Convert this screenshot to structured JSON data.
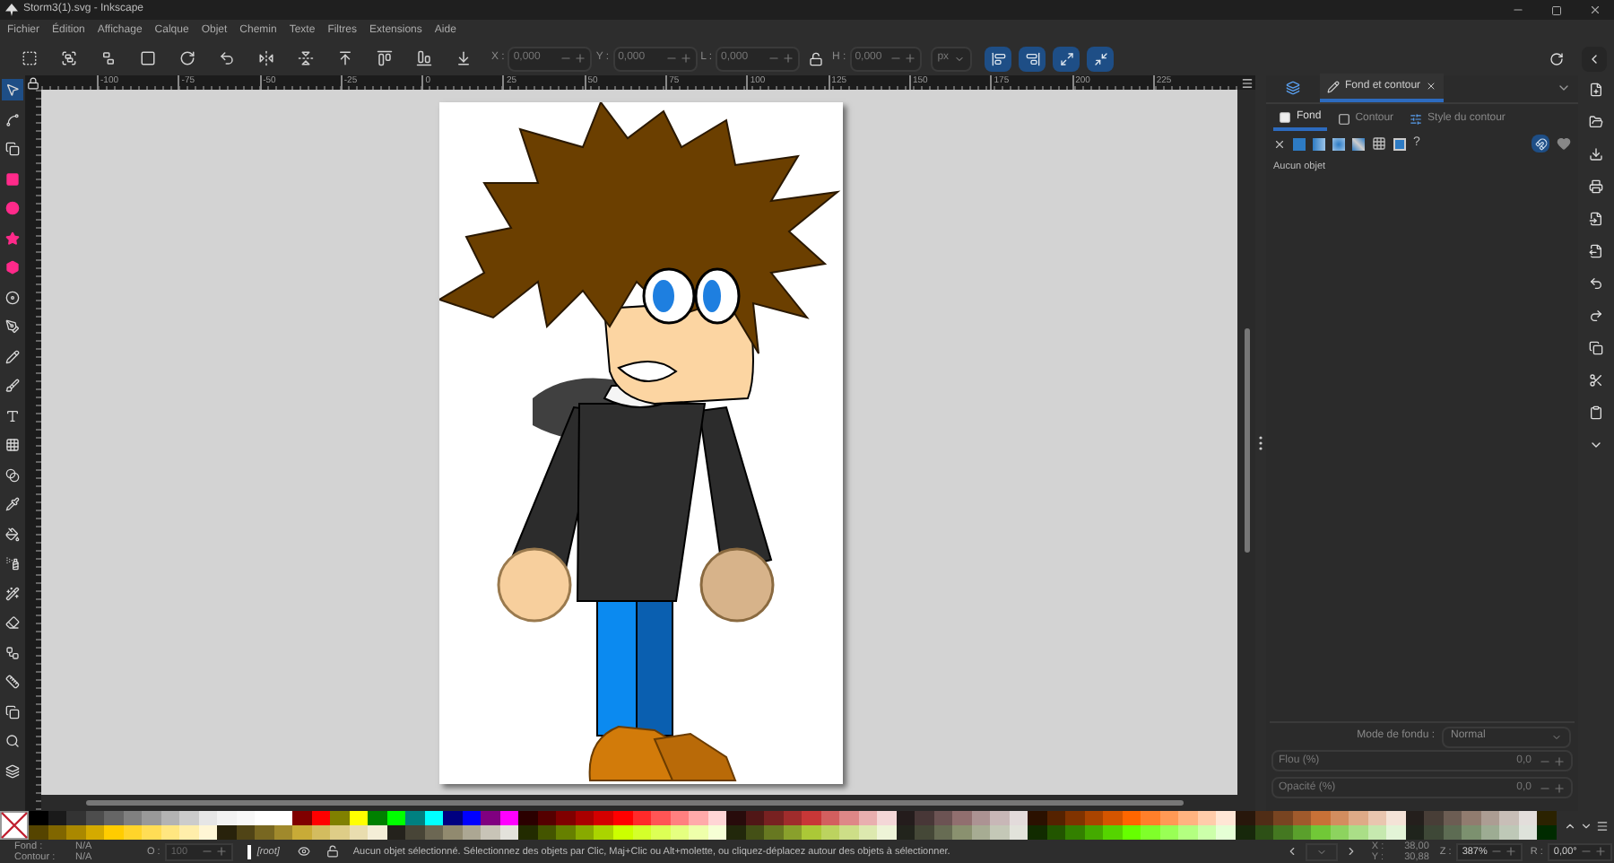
{
  "window": {
    "title": "Storm3(1).svg - Inkscape"
  },
  "menu": [
    "Fichier",
    "Édition",
    "Affichage",
    "Calque",
    "Objet",
    "Chemin",
    "Texte",
    "Filtres",
    "Extensions",
    "Aide"
  ],
  "toolbar": {
    "fields": [
      {
        "label": "X :",
        "value": "0,000"
      },
      {
        "label": "Y :",
        "value": "0,000"
      },
      {
        "label": "L :",
        "value": "0,000"
      },
      {
        "label": "H :",
        "value": "0,000"
      }
    ],
    "unit": "px"
  },
  "ruler": {
    "labels": [
      "-100",
      "-75",
      "-50",
      "-25",
      "0",
      "25",
      "50",
      "75",
      "100",
      "125",
      "150",
      "175",
      "200",
      "225"
    ]
  },
  "panel": {
    "tabs": [
      {
        "label": "Fond et contour",
        "selected": true
      }
    ],
    "subtabs": [
      {
        "label": "Fond",
        "selected": true
      },
      {
        "label": "Contour",
        "selected": false
      },
      {
        "label": "Style du contour",
        "selected": false
      }
    ],
    "unset_label": "?",
    "message": "Aucun objet",
    "blend": {
      "label": "Mode de fondu :",
      "value": "Normal"
    },
    "sliders": [
      {
        "label": "Flou (%)",
        "value": "0,0"
      },
      {
        "label": "Opacité (%)",
        "value": "0,0"
      }
    ]
  },
  "palette": {
    "rows": [
      [
        {
          "color": "#000000"
        },
        {
          "color": "#1a1a1a"
        },
        {
          "color": "#333333"
        },
        {
          "color": "#4d4d4d"
        },
        {
          "color": "#666666"
        },
        {
          "color": "#808080"
        },
        {
          "color": "#999999"
        },
        {
          "color": "#b3b3b3"
        },
        {
          "color": "#cccccc"
        },
        {
          "color": "#e6e6e6"
        },
        {
          "color": "#f2f2f2"
        },
        {
          "color": "#f8f8f8"
        },
        {
          "color": "#ffffff"
        },
        {
          "color": "#ffffff"
        },
        {
          "color": "#800000"
        },
        {
          "color": "#ff0000"
        },
        {
          "color": "#808000"
        },
        {
          "color": "#ffff00"
        },
        {
          "color": "#008000"
        },
        {
          "color": "#00ff00"
        },
        {
          "color": "#008080"
        },
        {
          "color": "#00ffff"
        },
        {
          "color": "#000080"
        },
        {
          "color": "#0000ff"
        },
        {
          "color": "#800080"
        },
        {
          "color": "#ff00ff"
        },
        {
          "color": "#2b0000"
        },
        {
          "color": "#550000"
        },
        {
          "color": "#800000"
        },
        {
          "color": "#aa0000"
        },
        {
          "color": "#d40000"
        },
        {
          "color": "#ff0000"
        },
        {
          "color": "#ff2a2a"
        },
        {
          "color": "#ff5555"
        },
        {
          "color": "#ff8080"
        },
        {
          "color": "#ffaaaa"
        },
        {
          "color": "#ffd5d5"
        },
        {
          "color": "#280b0b"
        },
        {
          "color": "#501616"
        },
        {
          "color": "#782121"
        },
        {
          "color": "#a02c2c"
        },
        {
          "color": "#c83737"
        },
        {
          "color": "#d35f5f"
        },
        {
          "color": "#de8787"
        },
        {
          "color": "#e9afaf"
        },
        {
          "color": "#f4d7d7"
        },
        {
          "color": "#241c1c"
        },
        {
          "color": "#483737"
        },
        {
          "color": "#6c5353"
        },
        {
          "color": "#916f6f"
        },
        {
          "color": "#ac9393"
        },
        {
          "color": "#c8b7b7"
        },
        {
          "color": "#e3dbdb"
        },
        {
          "color": "#2b1100"
        },
        {
          "color": "#552200"
        },
        {
          "color": "#803300"
        },
        {
          "color": "#aa4400"
        },
        {
          "color": "#d45500"
        },
        {
          "color": "#ff6600"
        },
        {
          "color": "#ff7f2a"
        },
        {
          "color": "#ff9955"
        },
        {
          "color": "#ffb380"
        },
        {
          "color": "#ffccaa"
        },
        {
          "color": "#ffe6d5"
        },
        {
          "color": "#28170b"
        },
        {
          "color": "#502d16"
        },
        {
          "color": "#784421"
        },
        {
          "color": "#a05a2c"
        },
        {
          "color": "#c87137"
        },
        {
          "color": "#d38d5f"
        },
        {
          "color": "#deaa87"
        },
        {
          "color": "#e9c6af"
        },
        {
          "color": "#f4e3d7"
        },
        {
          "color": "#241f1c"
        },
        {
          "color": "#483e37"
        },
        {
          "color": "#6c5d53"
        },
        {
          "color": "#917c6f"
        },
        {
          "color": "#ac9d93"
        },
        {
          "color": "#c8beb7"
        },
        {
          "color": "#e3dedb"
        },
        {
          "color": "#2b2200"
        }
      ],
      [
        {
          "color": "#554400"
        },
        {
          "color": "#806600"
        },
        {
          "color": "#aa8800"
        },
        {
          "color": "#d4aa00"
        },
        {
          "color": "#ffcc00"
        },
        {
          "color": "#ffd42a"
        },
        {
          "color": "#ffdd55"
        },
        {
          "color": "#ffe680"
        },
        {
          "color": "#ffeeaa"
        },
        {
          "color": "#fff6d5"
        },
        {
          "color": "#28220b"
        },
        {
          "color": "#504416"
        },
        {
          "color": "#786721"
        },
        {
          "color": "#a0892c"
        },
        {
          "color": "#c8ab37"
        },
        {
          "color": "#d3bc5f"
        },
        {
          "color": "#decd87"
        },
        {
          "color": "#e9ddaf"
        },
        {
          "color": "#f4eed7"
        },
        {
          "color": "#24221c"
        },
        {
          "color": "#484537"
        },
        {
          "color": "#6c6753"
        },
        {
          "color": "#918a6f"
        },
        {
          "color": "#aca793"
        },
        {
          "color": "#c8c4b7"
        },
        {
          "color": "#e3e2db"
        },
        {
          "color": "#222b00"
        },
        {
          "color": "#445500"
        },
        {
          "color": "#668000"
        },
        {
          "color": "#88aa00"
        },
        {
          "color": "#aad400"
        },
        {
          "color": "#ccff00"
        },
        {
          "color": "#d4ff2a"
        },
        {
          "color": "#ddff55"
        },
        {
          "color": "#e5ff80"
        },
        {
          "color": "#eeffaa"
        },
        {
          "color": "#f6ffd5"
        },
        {
          "color": "#22280b"
        },
        {
          "color": "#445016"
        },
        {
          "color": "#677821"
        },
        {
          "color": "#89a02c"
        },
        {
          "color": "#abc837"
        },
        {
          "color": "#bcd35f"
        },
        {
          "color": "#cdde87"
        },
        {
          "color": "#dde9af"
        },
        {
          "color": "#eef4d7"
        },
        {
          "color": "#22241c"
        },
        {
          "color": "#454837"
        },
        {
          "color": "#676c53"
        },
        {
          "color": "#8a916f"
        },
        {
          "color": "#a7ac93"
        },
        {
          "color": "#c4c8b7"
        },
        {
          "color": "#e2e3db"
        },
        {
          "color": "#112b00"
        },
        {
          "color": "#225500"
        },
        {
          "color": "#338000"
        },
        {
          "color": "#44aa00"
        },
        {
          "color": "#55d400"
        },
        {
          "color": "#66ff00"
        },
        {
          "color": "#7fff2a"
        },
        {
          "color": "#99ff55"
        },
        {
          "color": "#b3ff80"
        },
        {
          "color": "#ccffaa"
        },
        {
          "color": "#e5ffd5"
        },
        {
          "color": "#17280b"
        },
        {
          "color": "#2d5016"
        },
        {
          "color": "#447821"
        },
        {
          "color": "#5aa02c"
        },
        {
          "color": "#71c837"
        },
        {
          "color": "#8dd35f"
        },
        {
          "color": "#aade87"
        },
        {
          "color": "#c6e9af"
        },
        {
          "color": "#e3f4d7"
        },
        {
          "color": "#1f241c"
        },
        {
          "color": "#3e4837"
        },
        {
          "color": "#5d6c53"
        },
        {
          "color": "#7c916f"
        },
        {
          "color": "#9dac93"
        },
        {
          "color": "#bec8b7"
        },
        {
          "color": "#dee3db"
        },
        {
          "color": "#002b00"
        }
      ]
    ]
  },
  "status": {
    "fill_label": "Fond :",
    "fill_value": "N/A",
    "stroke_label": "Contour :",
    "stroke_value": "N/A",
    "opacity_label": "O :",
    "opacity_value": "100",
    "layer": "[root]",
    "message": "Aucun objet sélectionné. Sélectionnez des objets par Clic, Maj+Clic ou Alt+molette, ou cliquez-déplacez autour des objets à sélectionner.",
    "x_label": "X :",
    "x_value": "38,00",
    "y_label": "Y :",
    "y_value": "30,88",
    "zoom_label": "Z :",
    "zoom": "387%",
    "rotation_label": "R :",
    "rotation": "0,00°"
  }
}
